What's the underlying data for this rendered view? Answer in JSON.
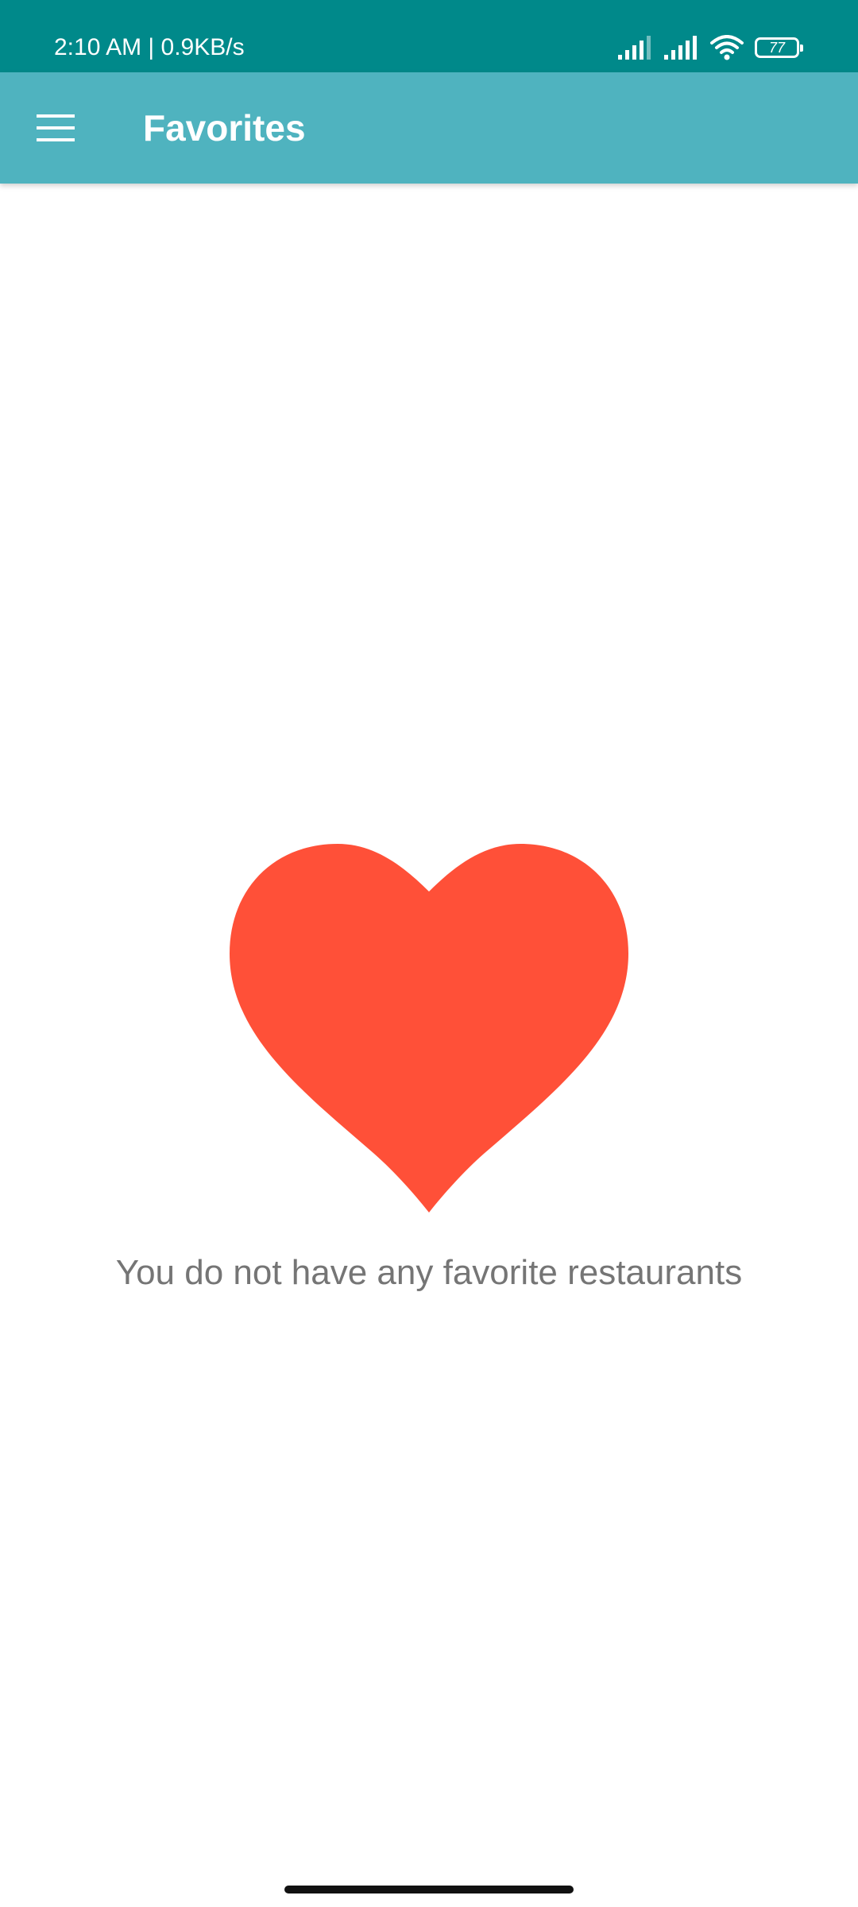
{
  "status_bar": {
    "time_speed": "2:10 AM | 0.9KB/s",
    "battery_level": "77",
    "icons": [
      "signal-icon",
      "signal-icon",
      "wifi-icon",
      "battery-icon"
    ]
  },
  "app_bar": {
    "title": "Favorites",
    "menu_icon": "hamburger-menu-icon"
  },
  "empty_state": {
    "icon": "heart-icon",
    "message": "You do not have any favorite restaurants"
  },
  "colors": {
    "status_bar": "#00898a",
    "app_bar": "#4fb3bf",
    "heart": "#ff5038",
    "message_text": "#757575"
  }
}
